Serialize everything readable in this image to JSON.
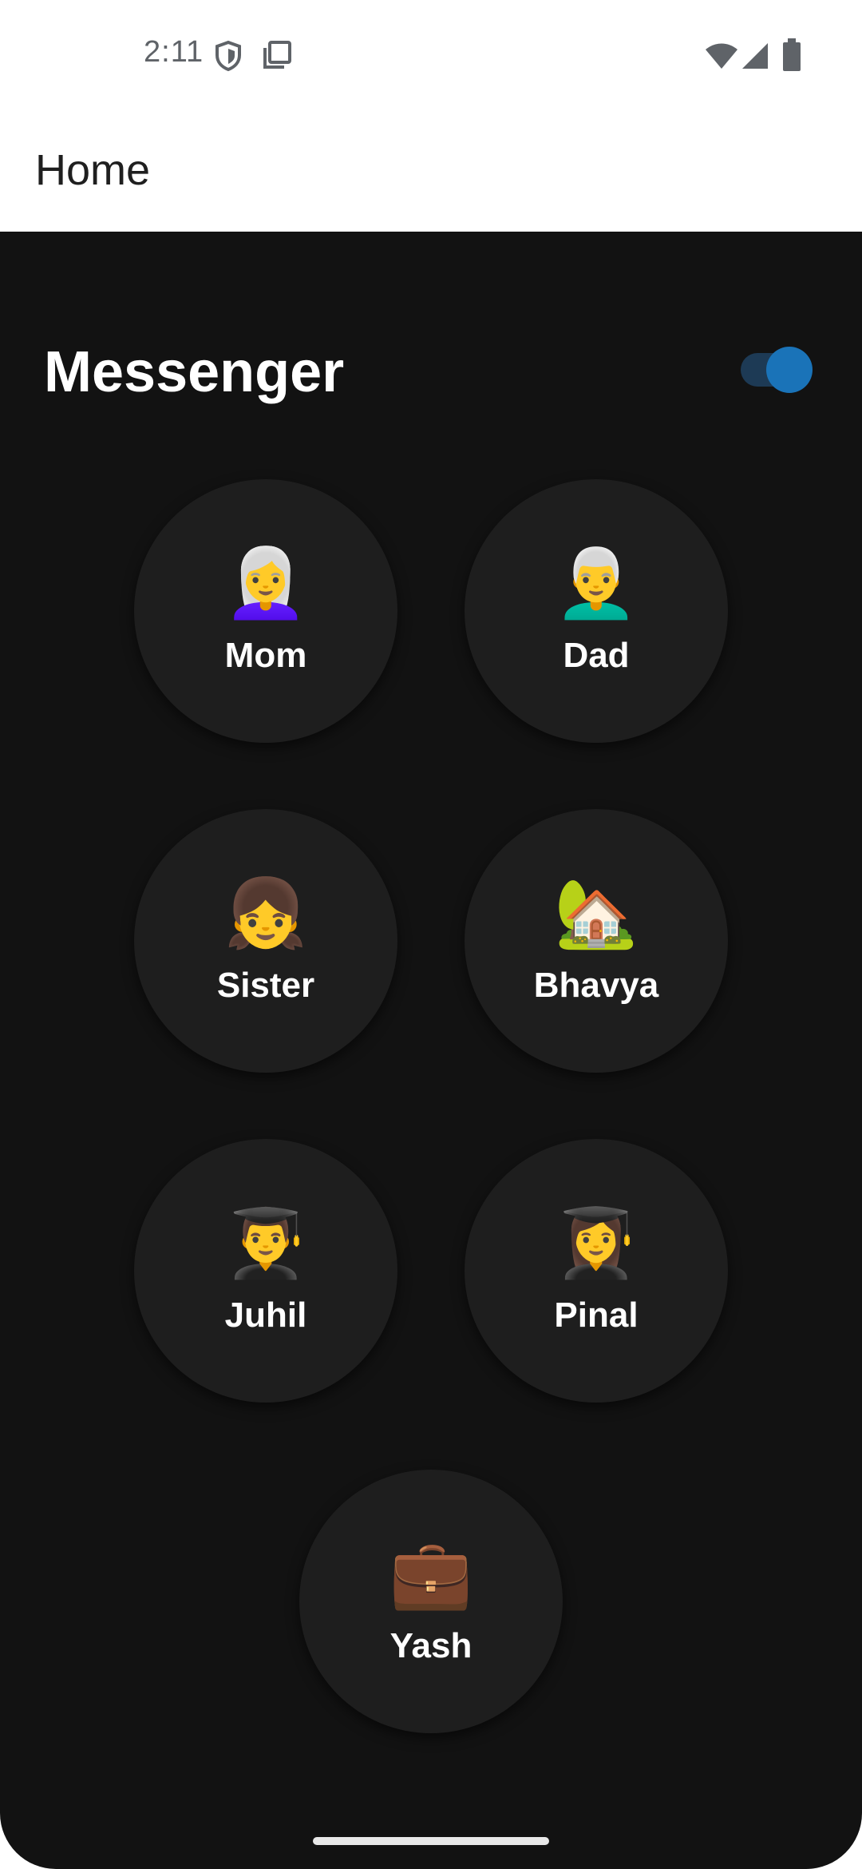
{
  "status_bar": {
    "time": "2:11",
    "icons": [
      "shield-icon",
      "screenshot-icon",
      "wifi-icon",
      "signal-icon",
      "battery-icon"
    ]
  },
  "app_bar": {
    "title": "Home"
  },
  "messenger": {
    "title": "Messenger",
    "toggle_on": true,
    "accent_color": "#1a73b8",
    "contacts": [
      {
        "name": "Mom",
        "emoji": "👩‍🦳"
      },
      {
        "name": "Dad",
        "emoji": "👨‍🦳"
      },
      {
        "name": "Sister",
        "emoji": "👧"
      },
      {
        "name": "Bhavya",
        "emoji": "🏡"
      },
      {
        "name": "Juhil",
        "emoji": "👨‍🎓"
      },
      {
        "name": "Pinal",
        "emoji": "👩‍🎓"
      },
      {
        "name": "Yash",
        "emoji": "💼"
      }
    ]
  }
}
